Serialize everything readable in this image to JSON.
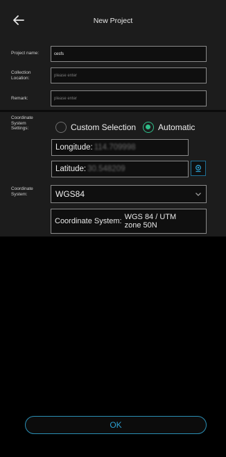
{
  "header": {
    "title": "New Project",
    "back_icon": "arrow-left-icon"
  },
  "form": {
    "project_name": {
      "label": "Project name:",
      "value": "cesfs"
    },
    "collection_location": {
      "label": "Collection Location:",
      "placeholder": "please enter"
    },
    "remark": {
      "label": "Remark:",
      "placeholder": "please enter"
    },
    "coordinate_settings": {
      "label": "Coordinate System Settings:",
      "options": [
        "Custom Selection",
        "Automatic"
      ],
      "selected": "Automatic"
    },
    "longitude": {
      "label": "Longitude:",
      "value": "114.709998"
    },
    "latitude": {
      "label": "Latitude:",
      "value": "30.548209"
    },
    "coordinate_system": {
      "label": "Coordinate System:",
      "value": "WGS84"
    },
    "coordinate_system_info": {
      "label": "Coordinate System:",
      "value": "WGS 84 / UTM zone 50N"
    }
  },
  "footer": {
    "ok_label": "OK"
  },
  "colors": {
    "accent_green": "#2fbf8a",
    "accent_blue": "#2a8fb5",
    "panel": "#1c1c1c",
    "background": "#000000"
  }
}
